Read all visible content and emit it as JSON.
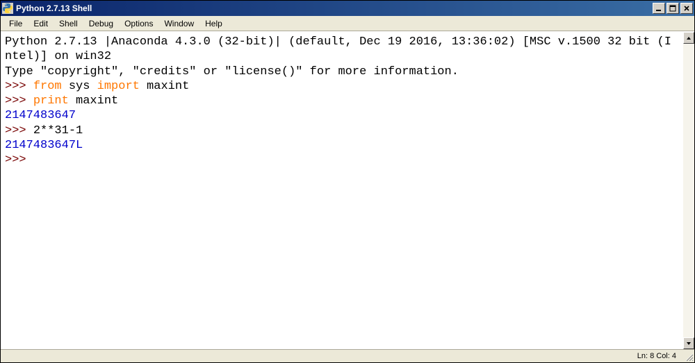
{
  "window": {
    "title": "Python 2.7.13 Shell"
  },
  "menu": {
    "file": "File",
    "edit": "Edit",
    "shell": "Shell",
    "debug": "Debug",
    "options": "Options",
    "window": "Window",
    "help": "Help"
  },
  "shell": {
    "banner1": "Python 2.7.13 |Anaconda 4.3.0 (32-bit)| (default, Dec 19 2016, 13:36:02) [MSC v.1500 32 bit (Intel)] on win32",
    "banner2": "Type \"copyright\", \"credits\" or \"license()\" for more information.",
    "prompt": ">>> ",
    "line1": {
      "kw1": "from",
      "mod": " sys ",
      "kw2": "import",
      "tail": " maxint"
    },
    "line2": {
      "kw1": "print",
      "tail": " maxint"
    },
    "out1": "2147483647",
    "line3": "2**31-1",
    "out2": "2147483647L"
  },
  "status": {
    "line_label": "Ln: ",
    "line_val": "8",
    "col_label": "  Col: ",
    "col_val": "4"
  }
}
